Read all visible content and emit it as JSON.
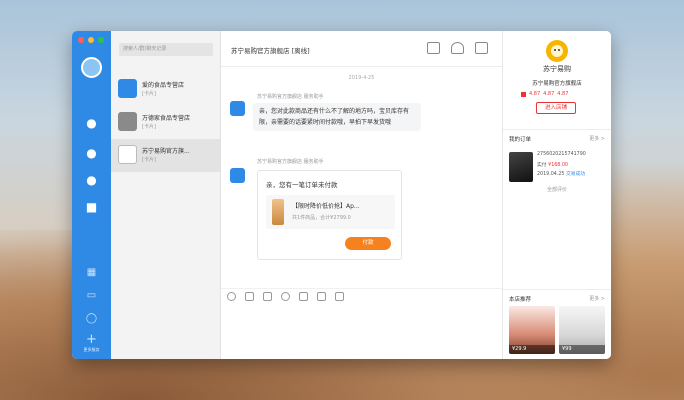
{
  "window": {
    "traffic_lights": [
      "#ff5f57",
      "#febc2e",
      "#28c840"
    ]
  },
  "rail": {
    "icons": [
      "chat-icon",
      "user-icon",
      "contacts-icon",
      "clipboard-icon"
    ],
    "bottom_icons": [
      "chart-icon",
      "folder-icon",
      "clock-icon",
      "plus-icon"
    ],
    "more_label": "更多服务"
  },
  "conversation_list": {
    "search_placeholder": "搜索人/群/聊天记录",
    "items": [
      {
        "title": "爱的食品专营店",
        "subtitle": "[卡片]"
      },
      {
        "title": "万德家食品专营店",
        "subtitle": "[卡片]"
      },
      {
        "title": "苏宁易购官方旗...",
        "subtitle": "[卡片]"
      }
    ]
  },
  "chat": {
    "title": "苏宁易购官方旗舰店 [离线]",
    "timestamp": "2019-4-25",
    "sender1": "苏宁易购官方旗舰店 服务助手",
    "message1": "亲，您对此款商品还有什么不了解的地方吗，宝贝库存有限，亲需要的话要紧时间付款哦，早拍下早发货哦",
    "sender2": "苏宁易购官方旗舰店 服务助手",
    "order_heading": "亲，您有一笔订单未付款",
    "product_name": "【限时降价低价抢】Ap...",
    "product_sub": "共1件商品，合计¥2799.0",
    "pay_label": "付款",
    "toolbar_icons": [
      "emoji-icon",
      "scissors-icon",
      "image-icon",
      "question-icon",
      "file-icon",
      "quick-reply-icon",
      "history-icon"
    ]
  },
  "shop_panel": {
    "logo_text": "苏宁易购",
    "shop_name": "苏宁易购官方旗舰店",
    "ratings": [
      "4.87",
      "4.87",
      "4.87"
    ],
    "follow_label": "进入店铺",
    "orders_title": "我的订单",
    "orders_more": "更多 >",
    "order_id": "2756020215741790",
    "order_price": "¥168.00",
    "order_status": "交易成功",
    "order_status_label": "实付",
    "order_date": "2019.04.25",
    "all_eval": "全部评价",
    "rec_title": "本店推荐",
    "rec_more": "更多 >",
    "rec_prices": [
      "¥29.9",
      "¥99"
    ]
  }
}
